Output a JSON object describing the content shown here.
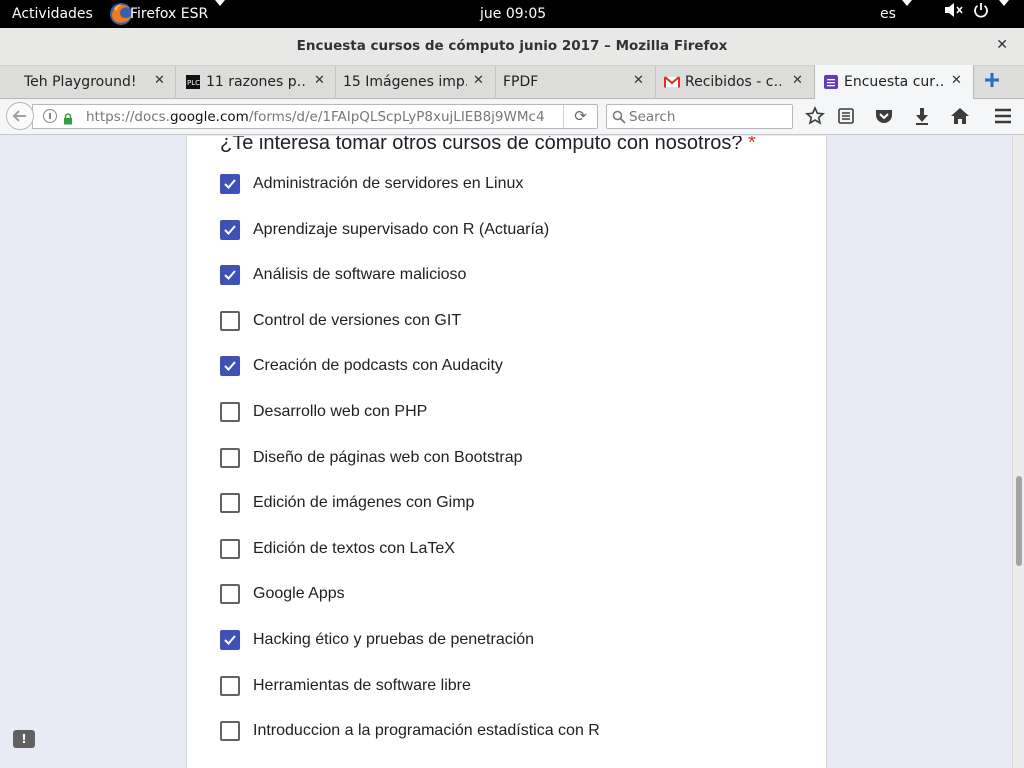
{
  "topbar": {
    "activities": "Actividades",
    "app_name": "Firefox ESR",
    "clock": "jue 09:05",
    "language": "es"
  },
  "window": {
    "title": "Encuesta cursos de cómputo junio 2017 – Mozilla Firefox"
  },
  "tabs": [
    {
      "label": "Teh Playground!",
      "icon": "none"
    },
    {
      "label": "11 razones p…",
      "icon": "plc-icon"
    },
    {
      "label": "15 Imágenes imp…",
      "icon": "none"
    },
    {
      "label": "FPDF",
      "icon": "none"
    },
    {
      "label": "Recibidos - c…",
      "icon": "gmail-icon"
    },
    {
      "label": "Encuesta cur…",
      "icon": "forms-icon",
      "active": true
    }
  ],
  "navbar": {
    "url_prefix": "https://docs.",
    "url_host": "google.com",
    "url_path": "/forms/d/e/1FAIpQLScpLyP8xujLIEB8j9WMc4",
    "search_placeholder": "Search"
  },
  "form": {
    "question": "¿Te interesa tomar otros cursos de cómputo con nosotros?",
    "required_mark": "*",
    "options": [
      {
        "label": "Administración de servidores en Linux",
        "checked": true
      },
      {
        "label": "Aprendizaje supervisado con R (Actuaría)",
        "checked": true
      },
      {
        "label": "Análisis de software malicioso",
        "checked": true
      },
      {
        "label": "Control de versiones con GIT",
        "checked": false
      },
      {
        "label": "Creación de podcasts con Audacity",
        "checked": true
      },
      {
        "label": "Desarrollo web con PHP",
        "checked": false
      },
      {
        "label": "Diseño de páginas web con Bootstrap",
        "checked": false
      },
      {
        "label": "Edición de imágenes con Gimp",
        "checked": false
      },
      {
        "label": "Edición de textos con LaTeX",
        "checked": false
      },
      {
        "label": "Google Apps",
        "checked": false
      },
      {
        "label": "Hacking ético y pruebas de penetración",
        "checked": true
      },
      {
        "label": "Herramientas de software libre",
        "checked": false
      },
      {
        "label": "Introduccion a la programación estadística con R",
        "checked": false
      }
    ]
  },
  "colors": {
    "checkbox_checked": "#3f51b5",
    "page_background": "#e8eaf6",
    "required": "#d93025"
  }
}
